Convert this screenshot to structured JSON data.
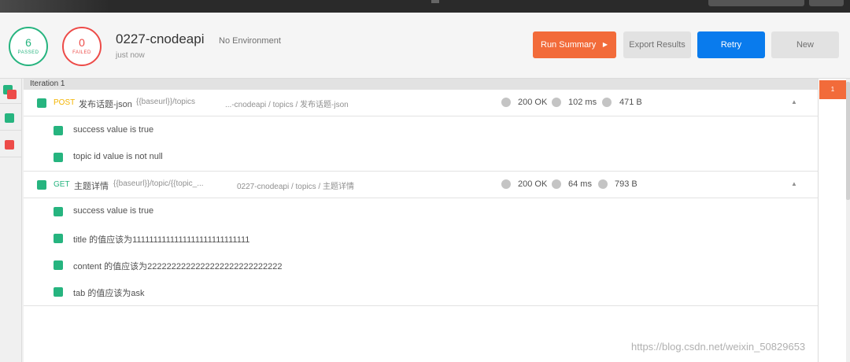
{
  "summary": {
    "passed_count": "6",
    "passed_label": "PASSED",
    "failed_count": "0",
    "failed_label": "FAILED",
    "collection_name": "0227-cnodeapi",
    "environment": "No Environment",
    "run_time": "just now"
  },
  "actions": {
    "run_summary": "Run Summary",
    "export_results": "Export Results",
    "retry": "Retry",
    "new": "New"
  },
  "iteration_label": "Iteration 1",
  "requests": [
    {
      "method": "POST",
      "name": "发布话题-json",
      "url": "{{baseurl}}/topics",
      "path": "...-cnodeapi / topics / 发布话题-json",
      "status": "200 OK",
      "time": "102 ms",
      "size": "471 B",
      "tests": [
        "success value is true",
        "topic id value is not null"
      ]
    },
    {
      "method": "GET",
      "name": "主题详情",
      "url": "{{baseurl}}/topic/{{topic_...",
      "path": "0227-cnodeapi / topics / 主题详情",
      "status": "200 OK",
      "time": "64 ms",
      "size": "793 B",
      "tests": [
        "success value is true",
        "title 的值应该为1111111111111111111111111111",
        "content 的值应该为2222222222222222222222222222",
        "tab 的值应该为ask"
      ]
    }
  ],
  "iteration_badge": "1",
  "watermark": "https://blog.csdn.net/weixin_50829653",
  "colors": {
    "pass": "#26b47f",
    "fail": "#ed4b48",
    "accent": "#f26b3a",
    "primary": "#097bed",
    "post": "#f4b400"
  },
  "icons": {
    "collapse": "chevron-up-icon",
    "summary_caret": "caret-right-icon"
  }
}
